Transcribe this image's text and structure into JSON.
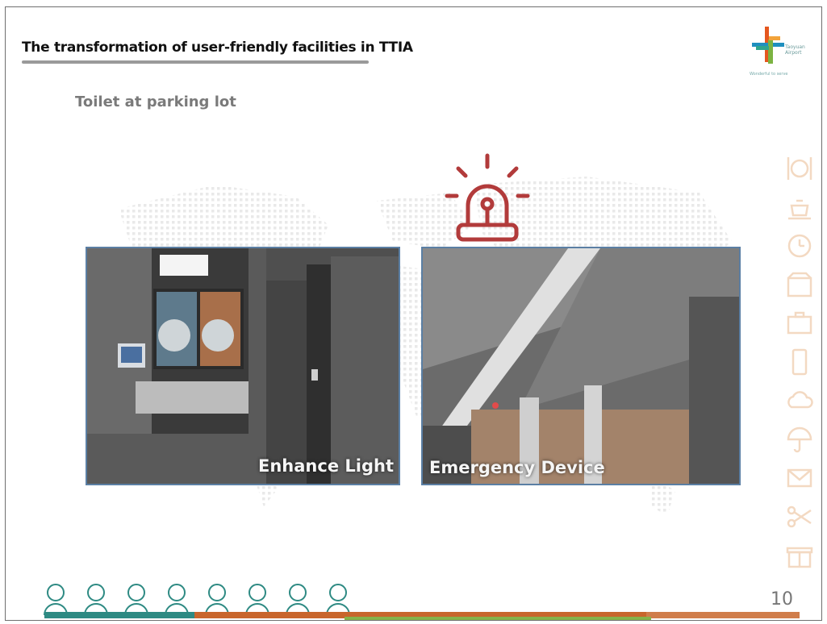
{
  "slide": {
    "title": "The transformation of user-friendly facilities in TTIA",
    "subtitle": "Toilet at parking lot",
    "page_number": "10"
  },
  "logo": {
    "line1": "Taoyuan",
    "line2": "Airport",
    "tagline": "Wonderful  to  serve"
  },
  "photos": [
    {
      "caption": "Enhance Light"
    },
    {
      "caption": "Emergency Device"
    }
  ],
  "colors": {
    "alarm_icon": "#b23b3b",
    "photo_border": "#5b7fa4",
    "bar_teal": "#2e8a83",
    "bar_orange": "#c8662c",
    "bar_green": "#86b34a",
    "side_icons": "#f3d9c2"
  },
  "icons": {
    "alarm": "emergency-siren-icon",
    "right_column": [
      "dining-icon",
      "teapot-icon",
      "clock-icon",
      "shop-icon",
      "luggage-icon",
      "phone-icon",
      "cloud-icon",
      "umbrella-icon",
      "mail-icon",
      "scissors-icon",
      "gift-icon"
    ],
    "people_row": [
      "person-icon-1",
      "person-icon-2",
      "person-icon-3",
      "person-icon-4",
      "person-icon-5",
      "person-icon-6",
      "person-icon-7",
      "person-icon-8"
    ]
  }
}
